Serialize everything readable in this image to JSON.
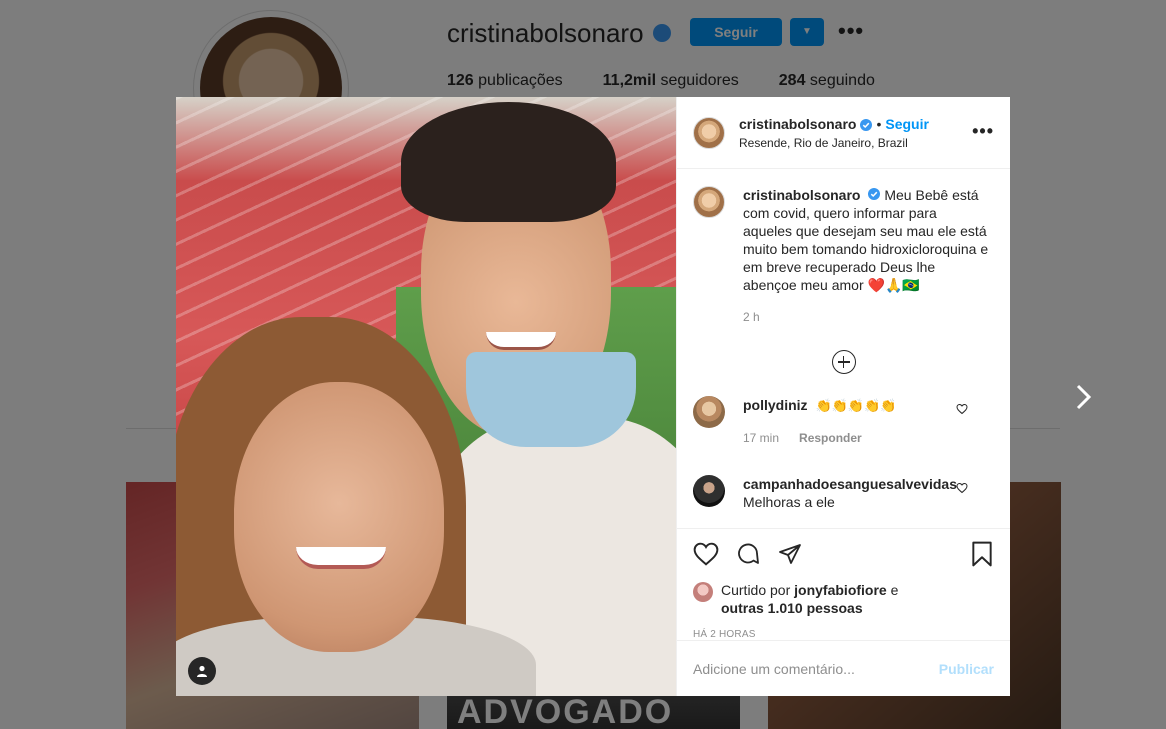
{
  "background_profile": {
    "username": "cristinabolsonaro",
    "follow_label": "Seguir",
    "posts_count": "126",
    "posts_label": "publicações",
    "followers_count": "11,2mil",
    "followers_label": "seguidores",
    "following_count": "284",
    "following_label": "seguindo",
    "tile_text": "ADVOGADO"
  },
  "post": {
    "author": "cristinabolsonaro",
    "separator": "•",
    "follow_label": "Seguir",
    "location": "Resende, Rio de Janeiro, Brazil",
    "caption": "Meu Bebê está com covid, quero informar para aqueles que desejam seu mau ele está muito bem tomando hidroxicloroquina e em breve recuperado Deus lhe abençoe meu amor ❤️🙏🇧🇷",
    "caption_time": "2 h",
    "liked_by_prefix": "Curtido por",
    "liked_by_user": "jonyfabiofiore",
    "liked_by_and": "e",
    "liked_by_others": "outras 1.010 pessoas",
    "posted_ago": "HÁ 2 HORAS",
    "comment_placeholder": "Adicione um comentário...",
    "publish_label": "Publicar"
  },
  "comments": [
    {
      "user": "pollydiniz",
      "text": "👏👏👏👏👏",
      "time": "17 min",
      "reply_label": "Responder"
    },
    {
      "user": "campanhadoesanguesalvevidas",
      "text": "Melhoras a ele"
    }
  ],
  "colors": {
    "accent": "#0095f6",
    "verified": "#3897f0",
    "publish_disabled": "#b2dffc"
  },
  "icons": [
    "verified-icon",
    "more-options-icon",
    "load-more-icon",
    "like-icon",
    "comment-icon",
    "share-icon",
    "save-icon",
    "user-tag-icon",
    "next-post-icon"
  ]
}
